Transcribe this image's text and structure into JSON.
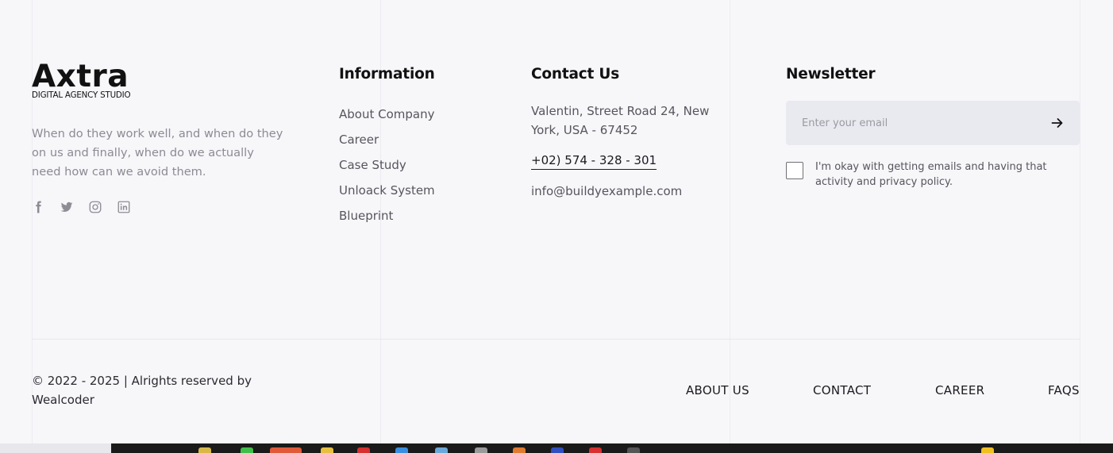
{
  "brand": {
    "logo_text": "Axtra",
    "logo_subtitle": "DIGITAL AGENCY STUDIO",
    "description": "When do they work well, and when do they on us and finally, when do we actually need how can we avoid them."
  },
  "socials": [
    "facebook-icon",
    "twitter-icon",
    "instagram-icon",
    "linkedin-icon"
  ],
  "information": {
    "title": "Information",
    "links": [
      "About Company",
      "Career",
      "Case Study",
      "Unloack System",
      "Blueprint"
    ]
  },
  "contact": {
    "title": "Contact Us",
    "address": "Valentin, Street Road 24, New York, USA - 67452",
    "phone": "+02) 574 - 328 - 301",
    "email": "info@buildyexample.com"
  },
  "newsletter": {
    "title": "Newsletter",
    "placeholder": "Enter your email",
    "consent_text": "I'm okay with getting emails and having that activity and privacy policy."
  },
  "footer": {
    "copyright": "© 2022 - 2025 | Alrights reserved by Wealcoder",
    "nav": [
      "ABOUT US",
      "CONTACT",
      "CAREER",
      "FAQS"
    ]
  },
  "colors": {
    "background": "#f7f7fa",
    "input_background": "#e9e9f0",
    "muted_text": "#8b8b93",
    "body_text": "#55555c",
    "heading_text": "#111111"
  }
}
